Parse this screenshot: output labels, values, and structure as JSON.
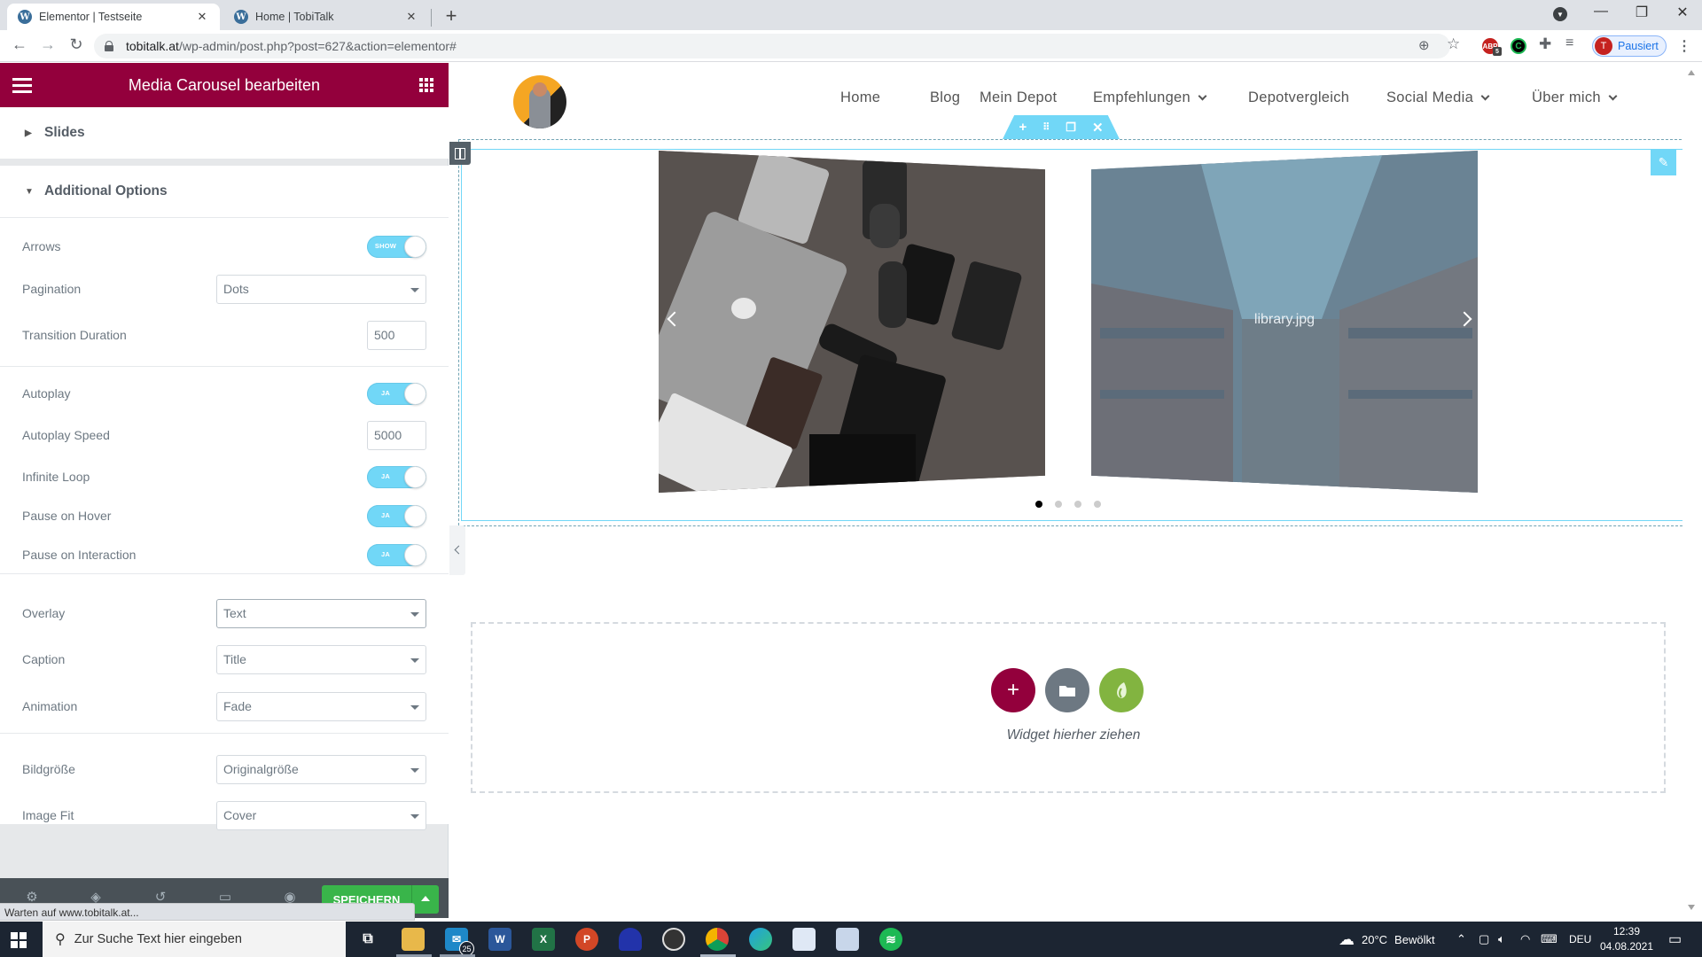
{
  "browser": {
    "tabs": [
      {
        "title": "Elementor | Testseite",
        "active": true
      },
      {
        "title": "Home | TobiTalk",
        "active": false
      }
    ],
    "url_host": "tobitalk.at",
    "url_path": "/wp-admin/post.php?post=627&action=elementor#",
    "profile_initial": "T",
    "profile_status": "Pausiert",
    "abp_badge": "5",
    "status_text": "Warten auf www.tobitalk.at..."
  },
  "panel": {
    "title": "Media Carousel bearbeiten",
    "sections": {
      "slides": "Slides",
      "additional": "Additional Options"
    },
    "controls": {
      "arrows": {
        "label": "Arrows",
        "value": "SHOW"
      },
      "pagination": {
        "label": "Pagination",
        "value": "Dots"
      },
      "transition_duration": {
        "label": "Transition Duration",
        "value": "500"
      },
      "autoplay": {
        "label": "Autoplay",
        "value": "JA"
      },
      "autoplay_speed": {
        "label": "Autoplay Speed",
        "value": "5000"
      },
      "infinite_loop": {
        "label": "Infinite Loop",
        "value": "JA"
      },
      "pause_on_hover": {
        "label": "Pause on Hover",
        "value": "JA"
      },
      "pause_on_interaction": {
        "label": "Pause on Interaction",
        "value": "JA"
      },
      "overlay": {
        "label": "Overlay",
        "value": "Text"
      },
      "caption": {
        "label": "Caption",
        "value": "Title"
      },
      "animation": {
        "label": "Animation",
        "value": "Fade"
      },
      "image_size": {
        "label": "Bildgröße",
        "value": "Originalgröße"
      },
      "image_fit": {
        "label": "Image Fit",
        "value": "Cover"
      }
    },
    "save_label": "SPEICHERN"
  },
  "site": {
    "nav": [
      {
        "label": "Home",
        "dropdown": false
      },
      {
        "label": "Blog",
        "dropdown": false
      },
      {
        "label": "Mein Depot",
        "dropdown": false
      },
      {
        "label": "Empfehlungen",
        "dropdown": true
      },
      {
        "label": "Depotvergleich",
        "dropdown": false
      },
      {
        "label": "Social Media",
        "dropdown": true
      },
      {
        "label": "Über mich",
        "dropdown": true
      }
    ],
    "carousel": {
      "slide2_caption": "library.jpg",
      "dots_total": 4,
      "active_dot": 1
    },
    "drop_zone_text": "Widget hierher ziehen"
  },
  "taskbar": {
    "search_placeholder": "Zur Suche Text hier eingeben",
    "mail_badge": "25",
    "weather_temp": "20°C",
    "weather_text": "Bewölkt",
    "language": "DEU",
    "time": "12:39",
    "date": "04.08.2021"
  },
  "colors": {
    "elementor_header": "#93003c",
    "toggle_on": "#71d7f7",
    "save_green": "#39b54a",
    "handle_blue": "#71d7f7",
    "add_button": "#93003c",
    "template_button": "#6d7882",
    "envato_button": "#82b440"
  }
}
